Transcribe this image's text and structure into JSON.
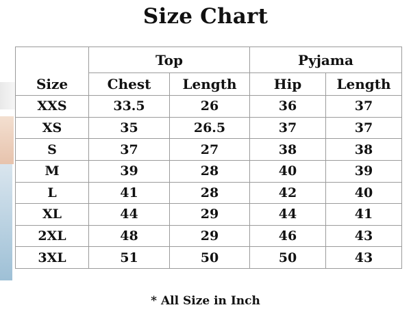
{
  "title": "Size Chart",
  "header": {
    "group_top": "Top",
    "group_pyjama": "Pyjama",
    "size": "Size",
    "chest": "Chest",
    "top_length": "Length",
    "hip": "Hip",
    "pyjama_length": "Length"
  },
  "rows": [
    {
      "size": "XXS",
      "chest": "33.5",
      "top_length": "26",
      "hip": "36",
      "pyjama_length": "37"
    },
    {
      "size": "XS",
      "chest": "35",
      "top_length": "26.5",
      "hip": "37",
      "pyjama_length": "37"
    },
    {
      "size": "S",
      "chest": "37",
      "top_length": "27",
      "hip": "38",
      "pyjama_length": "38"
    },
    {
      "size": "M",
      "chest": "39",
      "top_length": "28",
      "hip": "40",
      "pyjama_length": "39"
    },
    {
      "size": "L",
      "chest": "41",
      "top_length": "28",
      "hip": "42",
      "pyjama_length": "40"
    },
    {
      "size": "XL",
      "chest": "44",
      "top_length": "29",
      "hip": "44",
      "pyjama_length": "41"
    },
    {
      "size": "2XL",
      "chest": "48",
      "top_length": "29",
      "hip": "46",
      "pyjama_length": "43"
    },
    {
      "size": "3XL",
      "chest": "51",
      "top_length": "50",
      "hip": "50",
      "pyjama_length": "43"
    }
  ],
  "footnote": "* All Size in Inch",
  "colors": {
    "text": "#111111",
    "border": "#9a9a9a",
    "background": "#ffffff"
  }
}
